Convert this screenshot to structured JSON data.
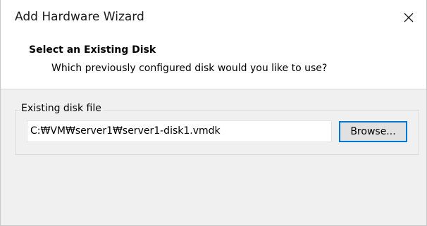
{
  "window": {
    "title": "Add Hardware Wizard",
    "close_icon": "close-icon"
  },
  "header": {
    "title": "Select an Existing Disk",
    "subtitle": "Which previously configured disk would you like to use?"
  },
  "disk_group": {
    "label": "Existing disk file",
    "path_value": "C:₩VM₩server1₩server1-disk1.vmdk",
    "browse_label": "Browse..."
  },
  "colors": {
    "focus_accent": "#0078d4",
    "dialog_background": "#f0f0f0",
    "header_background": "#ffffff"
  }
}
